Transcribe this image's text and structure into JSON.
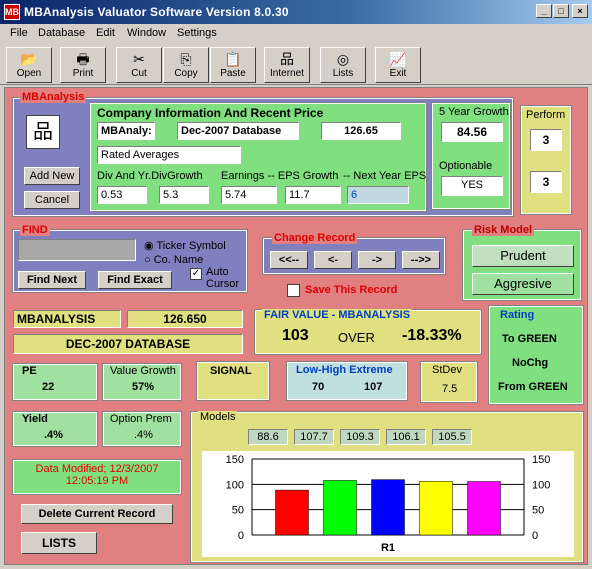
{
  "window": {
    "title": "MBAnalysis Valuator Software Version 8.0.30",
    "app_icon": "MB"
  },
  "menu": [
    "File",
    "Database",
    "Edit",
    "Window",
    "Settings"
  ],
  "toolbar": [
    {
      "label": "Open",
      "icon": "open-folder-icon"
    },
    {
      "label": "Print",
      "icon": "printer-icon"
    },
    {
      "label": "Cut",
      "icon": "scissors-icon"
    },
    {
      "label": "Copy",
      "icon": "copy-icon"
    },
    {
      "label": "Paste",
      "icon": "paste-icon"
    },
    {
      "label": "Internet",
      "icon": "network-icon"
    },
    {
      "label": "Lists",
      "icon": "cd-icon"
    },
    {
      "label": "Exit",
      "icon": "exit-chart-icon"
    }
  ],
  "mba": {
    "group_label": "MBAnalysis",
    "add_new": "Add New",
    "cancel": "Cancel",
    "company_title": "Company Information And Recent Price",
    "ticker": "MBAnaly:",
    "database": "Dec-2007 Database",
    "price": "126.65",
    "averages": "Rated Averages",
    "div_label": "Div  And  Yr.DivGrowth",
    "div": "0.53",
    "div_growth": "5.3",
    "earnings_label": "Earnings -- EPS Growth",
    "earnings": "5.74",
    "eps_growth": "11.7",
    "next_eps_label": "-- Next Year EPS",
    "next_eps": "6",
    "five_year_label": "5 Year Growth",
    "five_year": "84.56",
    "optionable_label": "Optionable",
    "optionable": "YES",
    "perform_label": "Perform",
    "perform1": "3",
    "perform2": "3"
  },
  "find": {
    "label": "FIND",
    "input_value": "",
    "ticker_symbol": "Ticker Symbol",
    "co_name": "Co. Name",
    "find_next": "Find Next",
    "find_exact": "Find Exact",
    "auto_cursor": "Auto Cursor"
  },
  "change": {
    "label": "Change Record",
    "first": "<<--",
    "prev": "<-",
    "next": "->",
    "last": "-->>",
    "save": "Save This Record"
  },
  "risk": {
    "label": "Risk Model",
    "prudent": "Prudent",
    "aggressive": "Aggresive"
  },
  "summary": {
    "name": "MBANALYSIS",
    "price": "126.650",
    "database": "DEC-2007 DATABASE"
  },
  "fair": {
    "label": "FAIR VALUE - MBANALYSIS",
    "value": "103",
    "over": "OVER",
    "pct": "-18.33%"
  },
  "rating": {
    "label": "Rating",
    "to_green": "To GREEN",
    "nochg": "NoChg",
    "from_green": "From GREEN"
  },
  "pe": {
    "label": "PE",
    "value": "22"
  },
  "value_growth": {
    "label": "Value Growth",
    "value": "57%"
  },
  "signal": {
    "label": "SIGNAL"
  },
  "low_high": {
    "label": "Low-High Extreme",
    "low": "70",
    "high": "107"
  },
  "stdev": {
    "label": "StDev",
    "value": "7.5"
  },
  "yield": {
    "label": "Yield",
    "value": ".4%"
  },
  "option_prem": {
    "label": "Option Prem",
    "value": ".4%"
  },
  "modified": {
    "line1": "Data Modified; 12/3/2007",
    "line2": "12:05:19 PM"
  },
  "delete_record": "Delete Current Record",
  "lists": "LISTS",
  "models": {
    "label": "Models",
    "values": [
      "88.6",
      "107.7",
      "109.3",
      "106.1",
      "105.5"
    ]
  },
  "chart_data": {
    "type": "bar",
    "categories": [
      "R1"
    ],
    "series": [
      {
        "values": [
          88.6
        ],
        "color": "#ff0000"
      },
      {
        "values": [
          107.7
        ],
        "color": "#00ff00"
      },
      {
        "values": [
          109.3
        ],
        "color": "#0000ff"
      },
      {
        "values": [
          106.1
        ],
        "color": "#ffff00"
      },
      {
        "values": [
          105.5
        ],
        "color": "#ff00ff"
      }
    ],
    "yticks": [
      "150",
      "100",
      "50",
      "0"
    ],
    "ylim": [
      0,
      150
    ],
    "xlabel": "R1",
    "grid": true
  }
}
